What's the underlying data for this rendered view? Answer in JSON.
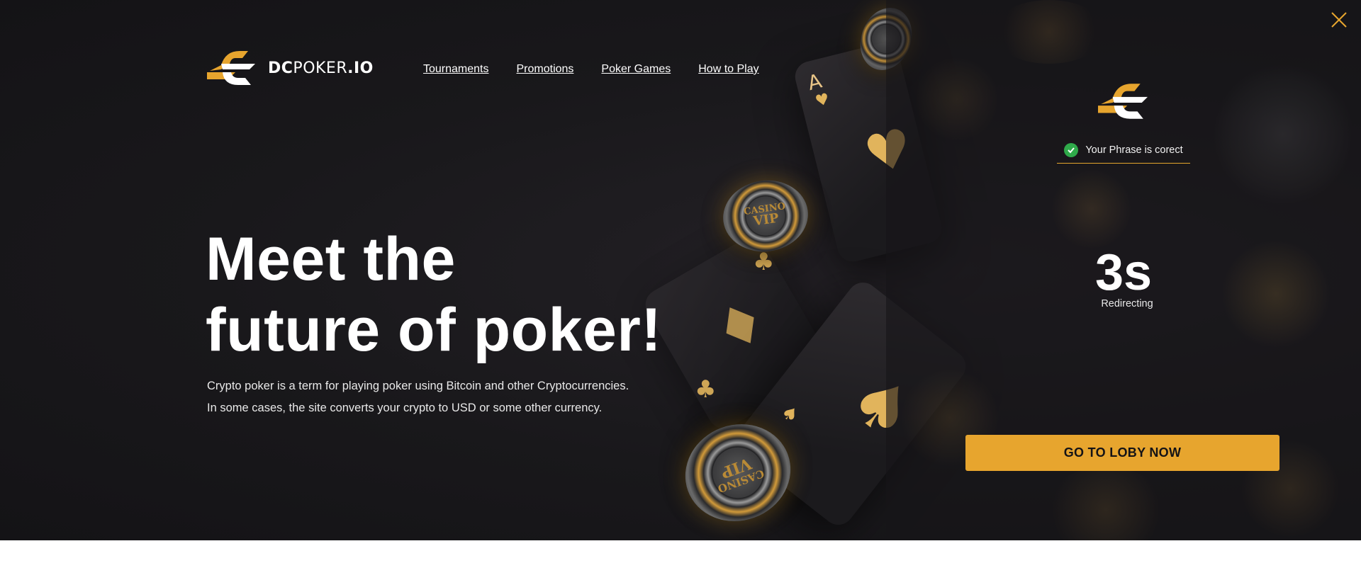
{
  "header": {
    "brand": {
      "bold": "DC",
      "regular": "POKER",
      "suffix": ".IO"
    },
    "nav": [
      "Tournaments",
      "Promotions",
      "Poker Games",
      "How to Play"
    ]
  },
  "hero": {
    "headline_line1": "Meet the",
    "headline_line2": "future of poker!",
    "subtext_line1": "Crypto poker is a term for playing poker using Bitcoin and other Cryptocurrencies.",
    "subtext_line2": "In some cases, the site converts your crypto to USD or some other currency."
  },
  "overlay": {
    "status_text": "Your Phrase is corect",
    "countdown": "3s",
    "countdown_label": "Redirecting",
    "cta_label": "GO TO LOBY NOW"
  },
  "decorations": {
    "card_rank": "A",
    "chip_text_top": "CASINO",
    "chip_text_bottom": "VIP"
  },
  "colors": {
    "accent": "#e7a52e",
    "background": "#19181b",
    "success": "#2faa4a"
  }
}
